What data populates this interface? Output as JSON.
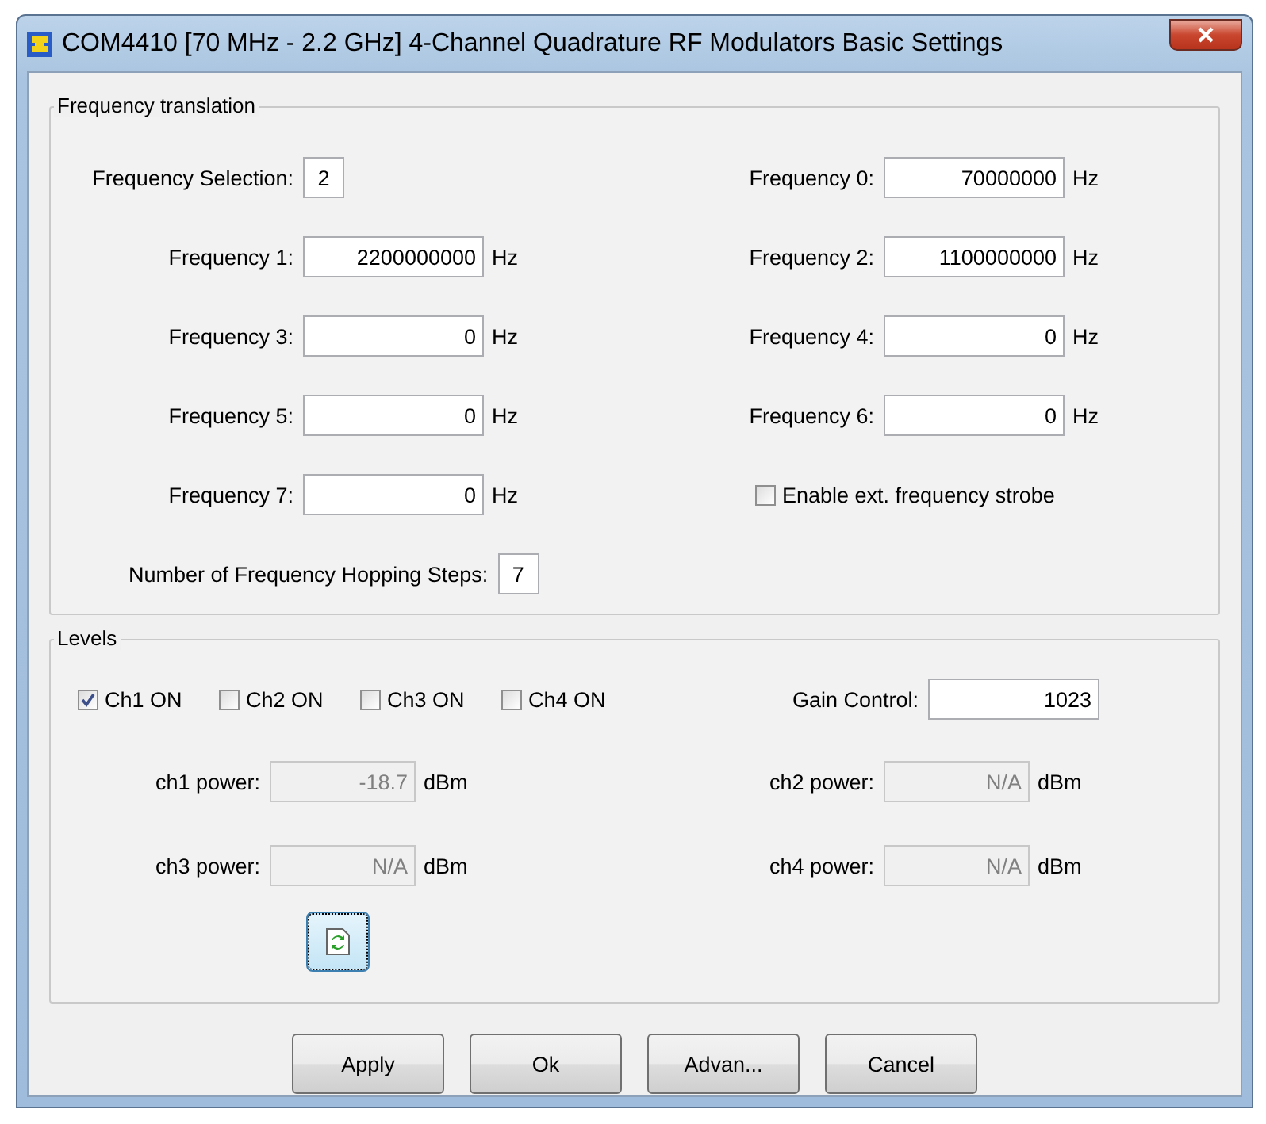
{
  "window": {
    "title": "COM4410 [70 MHz - 2.2 GHz] 4-Channel Quadrature RF Modulators Basic Settings"
  },
  "frequency": {
    "title": "Frequency translation",
    "items": [
      {
        "kind": "short",
        "label": "Frequency Selection:",
        "value": "2"
      },
      {
        "kind": "field",
        "label": "Frequency 0:",
        "value": "70000000",
        "unit": "Hz"
      },
      {
        "kind": "field",
        "label": "Frequency 1:",
        "value": "2200000000",
        "unit": "Hz"
      },
      {
        "kind": "field",
        "label": "Frequency 2:",
        "value": "1100000000",
        "unit": "Hz"
      },
      {
        "kind": "field",
        "label": "Frequency 3:",
        "value": "0",
        "unit": "Hz"
      },
      {
        "kind": "field",
        "label": "Frequency 4:",
        "value": "0",
        "unit": "Hz"
      },
      {
        "kind": "field",
        "label": "Frequency 5:",
        "value": "0",
        "unit": "Hz"
      },
      {
        "kind": "field",
        "label": "Frequency 6:",
        "value": "0",
        "unit": "Hz"
      },
      {
        "kind": "field",
        "label": "Frequency 7:",
        "value": "0",
        "unit": "Hz"
      },
      {
        "kind": "checkbox",
        "label": "Enable ext. frequency strobe",
        "checked": false
      },
      {
        "kind": "short",
        "label": "Number of Frequency Hopping Steps:",
        "value": "7"
      }
    ]
  },
  "levels": {
    "title": "Levels",
    "channels": [
      {
        "label": "Ch1 ON",
        "checked": true
      },
      {
        "label": "Ch2 ON",
        "checked": false
      },
      {
        "label": "Ch3 ON",
        "checked": false
      },
      {
        "label": "Ch4 ON",
        "checked": false
      }
    ],
    "gain": {
      "label": "Gain Control:",
      "value": "1023"
    },
    "powers": [
      {
        "label": "ch1 power:",
        "value": "-18.7",
        "unit": "dBm",
        "disabled": true
      },
      {
        "label": "ch2 power:",
        "value": "N/A",
        "unit": "dBm",
        "disabled": true
      },
      {
        "label": "ch3 power:",
        "value": "N/A",
        "unit": "dBm",
        "disabled": true
      },
      {
        "label": "ch4 power:",
        "value": "N/A",
        "unit": "dBm",
        "disabled": true
      }
    ]
  },
  "buttons": [
    "Apply",
    "Ok",
    "Advan...",
    "Cancel"
  ]
}
